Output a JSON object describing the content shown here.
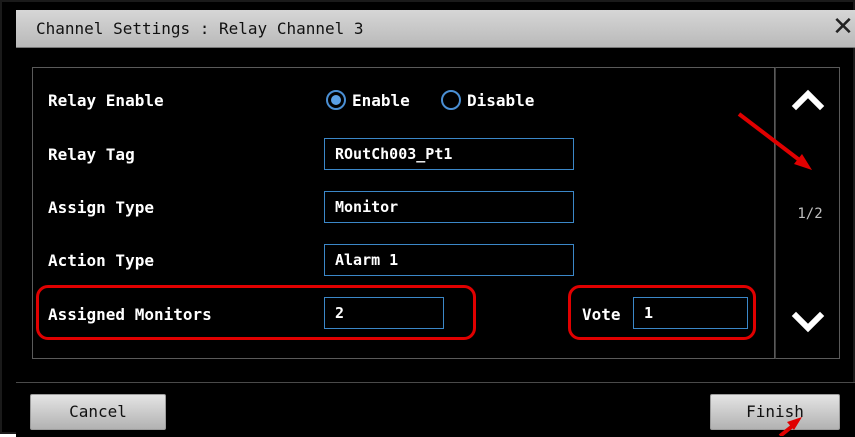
{
  "window": {
    "title": "Channel Settings : Relay Channel 3",
    "close_icon": "close-icon"
  },
  "fields": {
    "relay_enable": {
      "label": "Relay Enable",
      "options": [
        "Enable",
        "Disable"
      ],
      "selected": "Enable"
    },
    "relay_tag": {
      "label": "Relay Tag",
      "value": "ROutCh003_Pt1"
    },
    "assign_type": {
      "label": "Assign Type",
      "value": "Monitor"
    },
    "action_type": {
      "label": "Action Type",
      "value": "Alarm 1"
    },
    "assigned_monitors": {
      "label": "Assigned Monitors",
      "value": "2"
    },
    "vote": {
      "label": "Vote",
      "value": "1"
    }
  },
  "pagination": {
    "indicator": "1/2",
    "up_icon": "chevron-up-icon",
    "down_icon": "chevron-down-icon"
  },
  "buttons": {
    "cancel": "Cancel",
    "finish": "Finish"
  },
  "colors": {
    "field_border": "#3b87c8",
    "radio_selected": "#5aa0e6",
    "annotation": "#e00000",
    "background": "#000000"
  }
}
